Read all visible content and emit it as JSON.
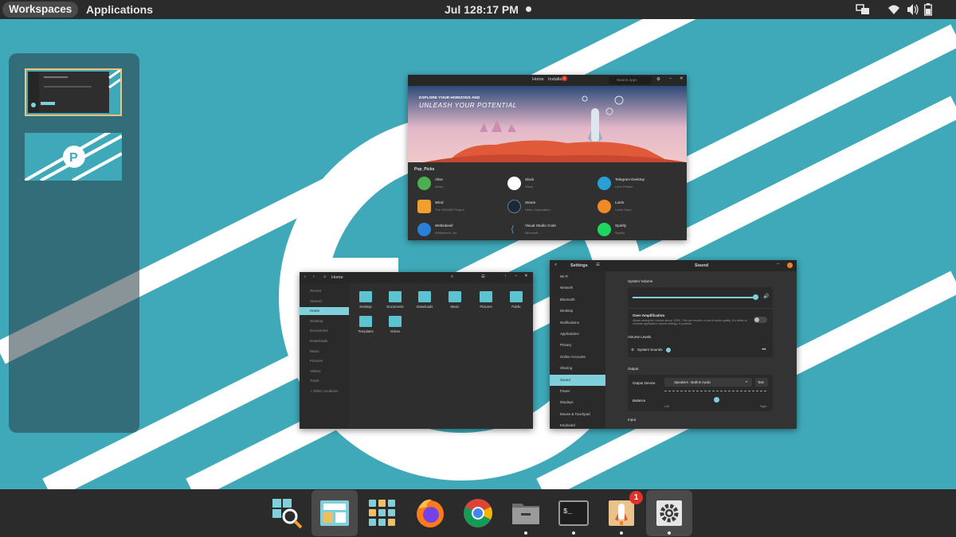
{
  "topbar": {
    "workspaces_label": "Workspaces",
    "applications_label": "Applications",
    "date": "Jul 12",
    "time": "8:17 PM"
  },
  "shop": {
    "tabs": [
      "Home",
      "Installed"
    ],
    "installed_badge": "5",
    "search_placeholder": "Search Apps",
    "banner_line1": "EXPLORE YOUR HORIZONS AND",
    "banner_line2": "UNLEASH YOUR POTENTIAL",
    "section_title": "Pop_Picks",
    "apps": [
      {
        "name": "Alive",
        "by": "Alfree",
        "color": "#4caf50"
      },
      {
        "name": "Slack",
        "by": "Slack",
        "color": "#ffffff"
      },
      {
        "name": "Telegram Desktop",
        "by": "Leon Peditor",
        "color": "#2a9fd6"
      },
      {
        "name": "Wind",
        "by": "The GNOME Project",
        "color": "#f0a030"
      },
      {
        "name": "Steam",
        "by": "Valve Corporation",
        "color": "#1b2838"
      },
      {
        "name": "Lutris",
        "by": "Lutris Team",
        "color": "#f08a24"
      },
      {
        "name": "Webinkeeil",
        "by": "Webinkeeil, Inc.",
        "color": "#2b7fd6"
      },
      {
        "name": "Visual Studio Code",
        "by": "Microsoft",
        "color": "#2f2f2f"
      },
      {
        "name": "Spotify",
        "by": "Spotify",
        "color": "#1ed760"
      }
    ]
  },
  "files": {
    "path": "Home",
    "sidebar": [
      "Recent",
      "Starred",
      "Home",
      "Desktop",
      "Documents",
      "Downloads",
      "Music",
      "Pictures",
      "Videos",
      "Trash",
      "+ Other Locations"
    ],
    "selected": 2,
    "folders": [
      "Desktop",
      "Documents",
      "Downloads",
      "Music",
      "Pictures",
      "Public",
      "Templates",
      "Videos"
    ]
  },
  "settings": {
    "title": "Settings",
    "page_title": "Sound",
    "sidebar": [
      "Wi-Fi",
      "Network",
      "Bluetooth",
      "Desktop",
      "Notifications",
      "Applications",
      "Privacy",
      "Online Accounts",
      "Sharing",
      "Sound",
      "Power",
      "Displays",
      "Mouse & Touchpad",
      "Keyboard"
    ],
    "selected": 9,
    "system_volume_label": "System Volume",
    "system_volume_value": 0.98,
    "over_amp_label": "Over-Amplification",
    "over_amp_desc": "Allows raising the volume above 100%. This can result in a loss of audio quality; it is better to increase application volume settings, if possible.",
    "volume_levels_label": "Volume Levels",
    "system_sounds_label": "System Sounds",
    "output_label": "Output",
    "output_device_label": "Output Device",
    "output_device_value": "Speakers - Built-in Audio",
    "test_label": "Test",
    "balance_label": "Balance",
    "balance_left": "Left",
    "balance_right": "Right",
    "input_label": "Input"
  },
  "dock": {
    "apps": [
      "Pop Launcher",
      "Workspaces",
      "Applications",
      "Firefox",
      "Chrome",
      "Files",
      "Terminal",
      "Pop Shop",
      "Settings"
    ],
    "shop_badge": "1"
  },
  "colors": {
    "wallpaper": "#3fa9b9",
    "accent": "#7fd0da",
    "panel": "#2b2b2b",
    "workspace_border": "#f2c27a"
  }
}
